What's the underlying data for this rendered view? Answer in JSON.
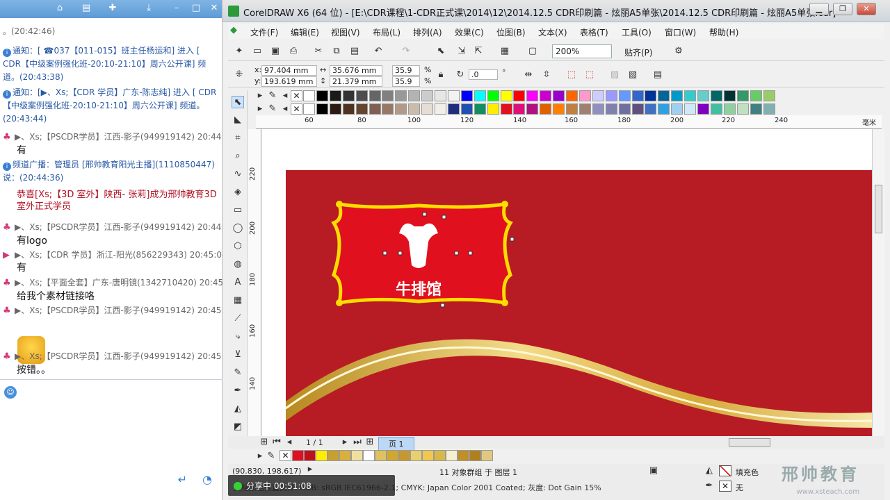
{
  "chat": {
    "messages": [
      {
        "kind": "time",
        "text": "。(20:42:46)"
      },
      {
        "kind": "info",
        "text": "通知：[ ☎037【011-015】班主任杨运和] 进入 [ CDR【中级案例强化班-20:10-21:10】周六公开课] 频道。(20:43:38)"
      },
      {
        "kind": "info",
        "text": "通知：[▶、Xs;【CDR 学员】广东-陈志纯] 进入 [ CDR【中级案例强化班-20:10-21:10】周六公开课] 频道。(20:43:44)"
      },
      {
        "kind": "meta",
        "text": "▶、Xs;【PSCDR学员】江西-影子(949919142) 20:44:3"
      },
      {
        "kind": "body",
        "text": "有"
      },
      {
        "kind": "info",
        "text": "频道广播：管理员 [邢帅教育阳光主播](1110850447) 说：(20:44:36)"
      },
      {
        "kind": "red",
        "text": "恭喜[Xs;【3D 室外】陕西- 张莉]成为邢帅教育3D室外正式学员"
      },
      {
        "kind": "meta",
        "text": "▶、Xs;【PSCDR学员】江西-影子(949919142) 20:44:3"
      },
      {
        "kind": "body",
        "text": "有logo"
      },
      {
        "kind": "meta",
        "text": "▶、Xs;【CDR 学员】浙江-阳光(856229343) 20:45:04"
      },
      {
        "kind": "body",
        "text": "有"
      },
      {
        "kind": "meta",
        "text": "▶、Xs;【平面全套】广东-唐明镜(1342710420) 20:45:"
      },
      {
        "kind": "body",
        "text": "给我个素材链接咯"
      },
      {
        "kind": "meta",
        "text": "▶、Xs;【PSCDR学员】江西-影子(949919142) 20:45:0"
      },
      {
        "kind": "meta",
        "text": "▶、Xs;【PSCDR学员】江西-影子(949919142) 20:45:1"
      },
      {
        "kind": "body",
        "text": "按错。。"
      }
    ]
  },
  "coreldraw": {
    "title": "CorelDRAW X6 (64 位) - [E:\\CDR课程\\1-CDR正式课\\2014\\12\\2014.12.5 CDR印刷篇 - 炫丽A5单张\\2014.12.5 CDR印刷篇 - 炫丽A5单张.cdr]",
    "menus": [
      "文件(F)",
      "编辑(E)",
      "视图(V)",
      "布局(L)",
      "排列(A)",
      "效果(C)",
      "位图(B)",
      "文本(X)",
      "表格(T)",
      "工具(O)",
      "窗口(W)",
      "帮助(H)"
    ],
    "zoom": "200%",
    "snap": "贴齐(P)",
    "props": {
      "x": "97.404 mm",
      "y": "193.619 mm",
      "w": "35.676 mm",
      "h": "21.379 mm",
      "sx": "35.9",
      "sy": "35.9",
      "pct": "%",
      "angle": ".0",
      "deg": "°"
    },
    "ruler_top": [
      "60",
      "80",
      "100",
      "120",
      "140",
      "160",
      "180",
      "200",
      "220",
      "240"
    ],
    "ruler_top_unit": "毫米",
    "ruler_left": [
      "220",
      "200",
      "180",
      "160",
      "140"
    ],
    "logo_text": "牛排馆",
    "page_nav": "1 / 1",
    "page_tab": "页 1",
    "coords": "(90.830, 198.617)",
    "status": "11 对象群组 于 图层 1",
    "fill_label": "填充色",
    "outline_label": "无",
    "color_profile": "文档颜色预置文件: RGB: sRGB IEC61966-2.1; CMYK: Japan Color 2001 Coated; 灰度: Dot Gain 15%"
  },
  "share": {
    "label": "分享中 00:51:08"
  },
  "watermark": {
    "text": "邢帅教育",
    "url": "www.xsteach.com"
  },
  "palette_row1": [
    "#ffffff",
    "#000000",
    "#1a1a1a",
    "#333333",
    "#4d4d4d",
    "#666666",
    "#808080",
    "#999999",
    "#b3b3b3",
    "#cccccc",
    "#e6e6e6",
    "#f2f2f2",
    "#0000ff",
    "#00ffff",
    "#00ff00",
    "#ffff00",
    "#ff0000",
    "#ff00ff",
    "#cc00cc",
    "#9900cc",
    "#ff6600",
    "#ff99cc",
    "#ccccff",
    "#9999ff",
    "#6699ff",
    "#3366cc",
    "#003399",
    "#006699",
    "#0099cc",
    "#33cccc",
    "#66cccc",
    "#006666",
    "#003333",
    "#339966",
    "#66cc66",
    "#99cc66"
  ],
  "palette_row2": [
    "#ffffff",
    "#000000",
    "#2b1a12",
    "#4d3320",
    "#66442e",
    "#806050",
    "#997766",
    "#b39a88",
    "#ccbbaa",
    "#e6ddd4",
    "#f3eee8",
    "#1f2d80",
    "#2050b0",
    "#109060",
    "#ffee00",
    "#e01020",
    "#e0107a",
    "#b01080",
    "#e06000",
    "#ff8000",
    "#c08040",
    "#a08070",
    "#9090c0",
    "#8080b0",
    "#7070a0",
    "#605080",
    "#4070c0",
    "#30a0e0",
    "#a0d0f0",
    "#d0e8f8",
    "#8000c0",
    "#40c0a0",
    "#90d0a0",
    "#c0e0c0",
    "#408080",
    "#80b0b0"
  ],
  "doc_palette": [
    "#e01020",
    "#c0101c",
    "#ffee00",
    "#c8a030",
    "#d8b040",
    "#f0e0a0",
    "#ffffff",
    "#e0c060",
    "#d0a830",
    "#c89830",
    "#e8d070",
    "#f0c850",
    "#d8b848",
    "#f5f0d0",
    "#c09028",
    "#b08020",
    "#e0c880"
  ]
}
